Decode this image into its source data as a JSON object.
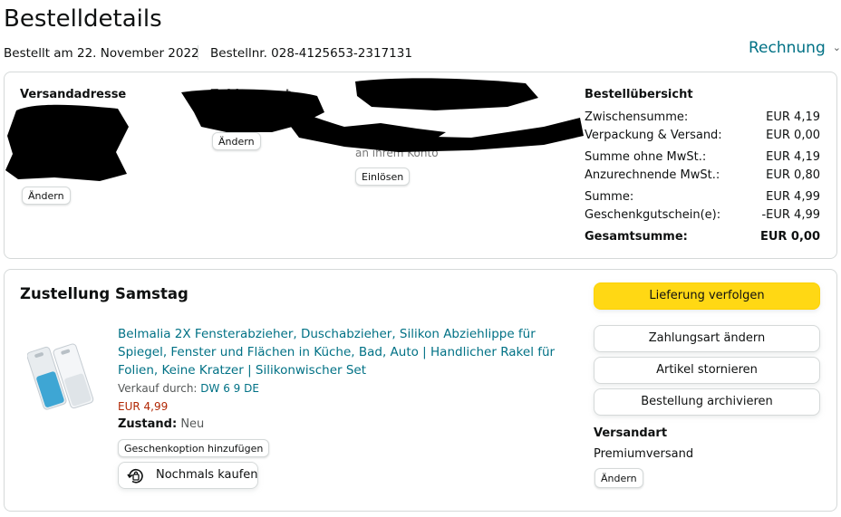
{
  "header": {
    "title": "Bestelldetails",
    "order_date": "Bestellt am 22. November 2022",
    "order_number": "Bestellnr. 028-4125653-2317131",
    "invoice_label": "Rechnung",
    "invoice_icon": "chevron-down-icon"
  },
  "addresses": {
    "shipping_heading": "Versandadresse",
    "payment_heading_partial": "Zahlungsart",
    "payment_text_partial": "an ihrem Konto",
    "change_address_label": "Ändern",
    "change_payment_label": "Ändern",
    "redeem_label": "Einlösen"
  },
  "summary": {
    "heading": "Bestellübersicht",
    "rows": [
      {
        "label": "Zwischensumme:",
        "value": "EUR 4,19"
      },
      {
        "label": "Verpackung & Versand:",
        "value": "EUR 0,00"
      },
      {
        "label": "Summe ohne MwSt.:",
        "value": "EUR 4,19"
      },
      {
        "label": "Anzurechnende MwSt.:",
        "value": "EUR 0,80"
      },
      {
        "label": "Summe:",
        "value": "EUR 4,99"
      },
      {
        "label": "Geschenkgutschein(e):",
        "value": "-EUR 4,99"
      }
    ],
    "total_label": "Gesamtsumme:",
    "total_value": "EUR 0,00"
  },
  "shipment": {
    "heading": "Zustellung Samstag",
    "product_title": "Belmalia 2X Fensterabzieher, Duschabzieher, Silikon Abziehlippe für Spiegel, Fenster und Flächen in Küche, Bad, Auto | Handlicher Rakel für Folien, Keine Kratzer | Silikonwischer Set",
    "sold_by_label": "Verkauf durch:",
    "seller": "DW 6 9 DE",
    "price": "EUR 4,99",
    "condition_label": "Zustand:",
    "condition_value": "Neu",
    "gift_option_label": "Geschenkoption hinzufügen",
    "buy_again_label": "Nochmals kaufen",
    "buy_again_icon": "buy-again-icon"
  },
  "actions": {
    "track_label": "Lieferung verfolgen",
    "change_payment_label": "Zahlungsart ändern",
    "cancel_label": "Artikel stornieren",
    "archive_label": "Bestellung archivieren",
    "shipping_method_heading": "Versandart",
    "shipping_method_value": "Premiumversand",
    "change_label": "Ändern"
  },
  "colors": {
    "link": "#007185",
    "price": "#b12704",
    "primary_button": "#ffd814",
    "border": "#d5d9d9"
  }
}
